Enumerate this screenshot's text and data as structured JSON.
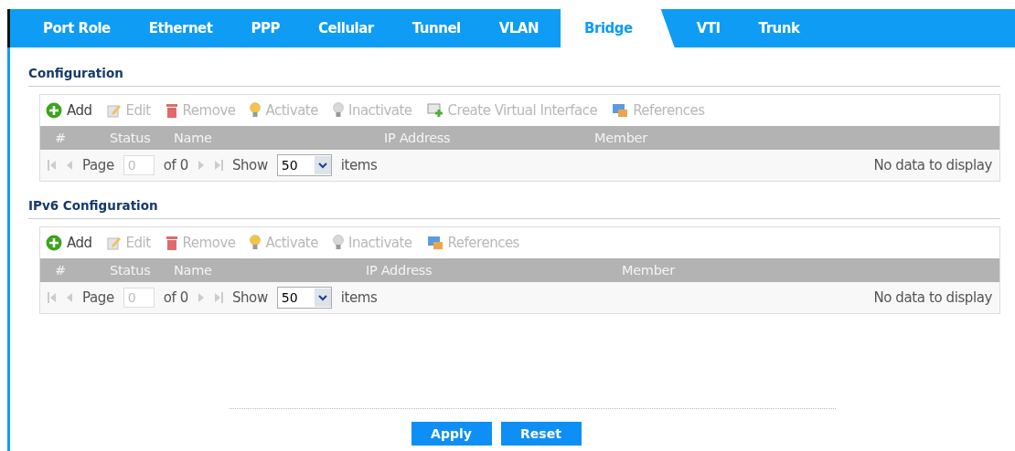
{
  "tabs": [
    {
      "label": "Port Role",
      "selected": false
    },
    {
      "label": "Ethernet",
      "selected": false
    },
    {
      "label": "PPP",
      "selected": false
    },
    {
      "label": "Cellular",
      "selected": false
    },
    {
      "label": "Tunnel",
      "selected": false
    },
    {
      "label": "VLAN",
      "selected": false
    },
    {
      "label": "Bridge",
      "selected": true
    },
    {
      "label": "VTI",
      "selected": false
    },
    {
      "label": "Trunk",
      "selected": false
    }
  ],
  "sections": [
    {
      "title": "Configuration",
      "toolbar": [
        {
          "kind": "add",
          "label": "Add",
          "disabled": false
        },
        {
          "kind": "edit",
          "label": "Edit",
          "disabled": true
        },
        {
          "kind": "remove",
          "label": "Remove",
          "disabled": true
        },
        {
          "kind": "activate",
          "label": "Activate",
          "disabled": true
        },
        {
          "kind": "inactivate",
          "label": "Inactivate",
          "disabled": true
        },
        {
          "kind": "virtual",
          "label": "Create Virtual Interface",
          "disabled": true
        },
        {
          "kind": "references",
          "label": "References",
          "disabled": true
        }
      ],
      "columns": [
        "#",
        "Status",
        "Name",
        "IP Address",
        "Member"
      ],
      "pager": {
        "page_label": "Page",
        "page_value": "0",
        "of": "of 0",
        "show": "Show",
        "per_page": "50",
        "items": "items",
        "empty": "No data to display"
      }
    },
    {
      "title": "IPv6 Configuration",
      "toolbar": [
        {
          "kind": "add",
          "label": "Add",
          "disabled": false
        },
        {
          "kind": "edit",
          "label": "Edit",
          "disabled": true
        },
        {
          "kind": "remove",
          "label": "Remove",
          "disabled": true
        },
        {
          "kind": "activate",
          "label": "Activate",
          "disabled": true
        },
        {
          "kind": "inactivate",
          "label": "Inactivate",
          "disabled": true
        },
        {
          "kind": "references",
          "label": "References",
          "disabled": true
        }
      ],
      "columns": [
        "#",
        "Status",
        "Name",
        "IP Address",
        "Member"
      ],
      "pager": {
        "page_label": "Page",
        "page_value": "0",
        "of": "of 0",
        "show": "Show",
        "per_page": "50",
        "items": "items",
        "empty": "No data to display"
      }
    }
  ],
  "buttons": [
    "Apply",
    "Reset"
  ]
}
